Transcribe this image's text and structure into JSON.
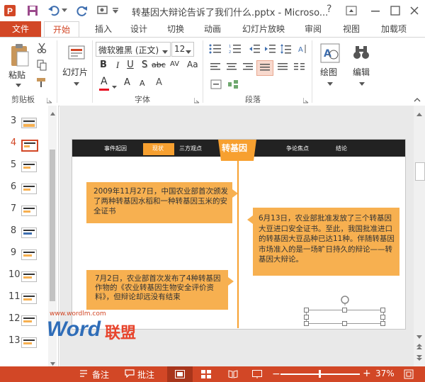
{
  "window": {
    "title": "转基因大辩论告诉了我们什么.pptx - Microso...",
    "help": "?"
  },
  "tabs": {
    "file": "文件",
    "items": [
      "开始",
      "插入",
      "设计",
      "切换",
      "动画",
      "幻灯片放映",
      "审阅",
      "视图",
      "加载项"
    ]
  },
  "ribbon": {
    "paste": "粘贴",
    "slides": "幻灯片",
    "font_name": "微软雅黑 (正文)",
    "font_size": "12",
    "bold": "B",
    "italic": "I",
    "underline": "U",
    "strike_s": "S",
    "abc": "abc",
    "av": "AV",
    "aa": "Aa",
    "font_a": "A",
    "font_a_up": "A",
    "font_a_down": "A",
    "font_a_clear": "A",
    "drawing": "绘图",
    "editing": "编辑",
    "groups": {
      "clipboard": "剪贴板",
      "font": "字体",
      "paragraph": "段落"
    }
  },
  "thumbnails": [
    {
      "num": "3",
      "active": false
    },
    {
      "num": "4",
      "active": true
    },
    {
      "num": "5",
      "active": false
    },
    {
      "num": "6",
      "active": false
    },
    {
      "num": "7",
      "active": false
    },
    {
      "num": "8",
      "active": false
    },
    {
      "num": "9",
      "active": false
    },
    {
      "num": "10",
      "active": false
    },
    {
      "num": "11",
      "active": false
    },
    {
      "num": "12",
      "active": false
    },
    {
      "num": "13",
      "active": false
    }
  ],
  "slide": {
    "nav": [
      "事件起因",
      "现状",
      "三方观点",
      "转基因",
      "争论焦点",
      "结论"
    ],
    "box1": "2009年11月27日，中国农业部首次颁发了两种转基因水稻和一种转基因玉米的安全证书",
    "box2": "6月13日，农业部批准发放了三个转基因大豆进口安全证书。至此，我国批准进口的转基因大豆品种已达11种。伴随转基因市场准入的是一场旷日持久的辩论——转基因大辩论。",
    "box3": "7月2日，农业部首次发布了4种转基因作物的《农业转基因生物安全评价资料》，但辩论却远没有结束"
  },
  "watermark": {
    "url": "www.wordlm.com",
    "brand_w": "Word",
    "brand_cn": "联盟"
  },
  "status": {
    "notes": "备注",
    "comments": "批注",
    "zoom": "37%"
  },
  "colors": {
    "accent": "#d24726",
    "orange_box": "#f7b050",
    "slide_header": "#222222"
  }
}
